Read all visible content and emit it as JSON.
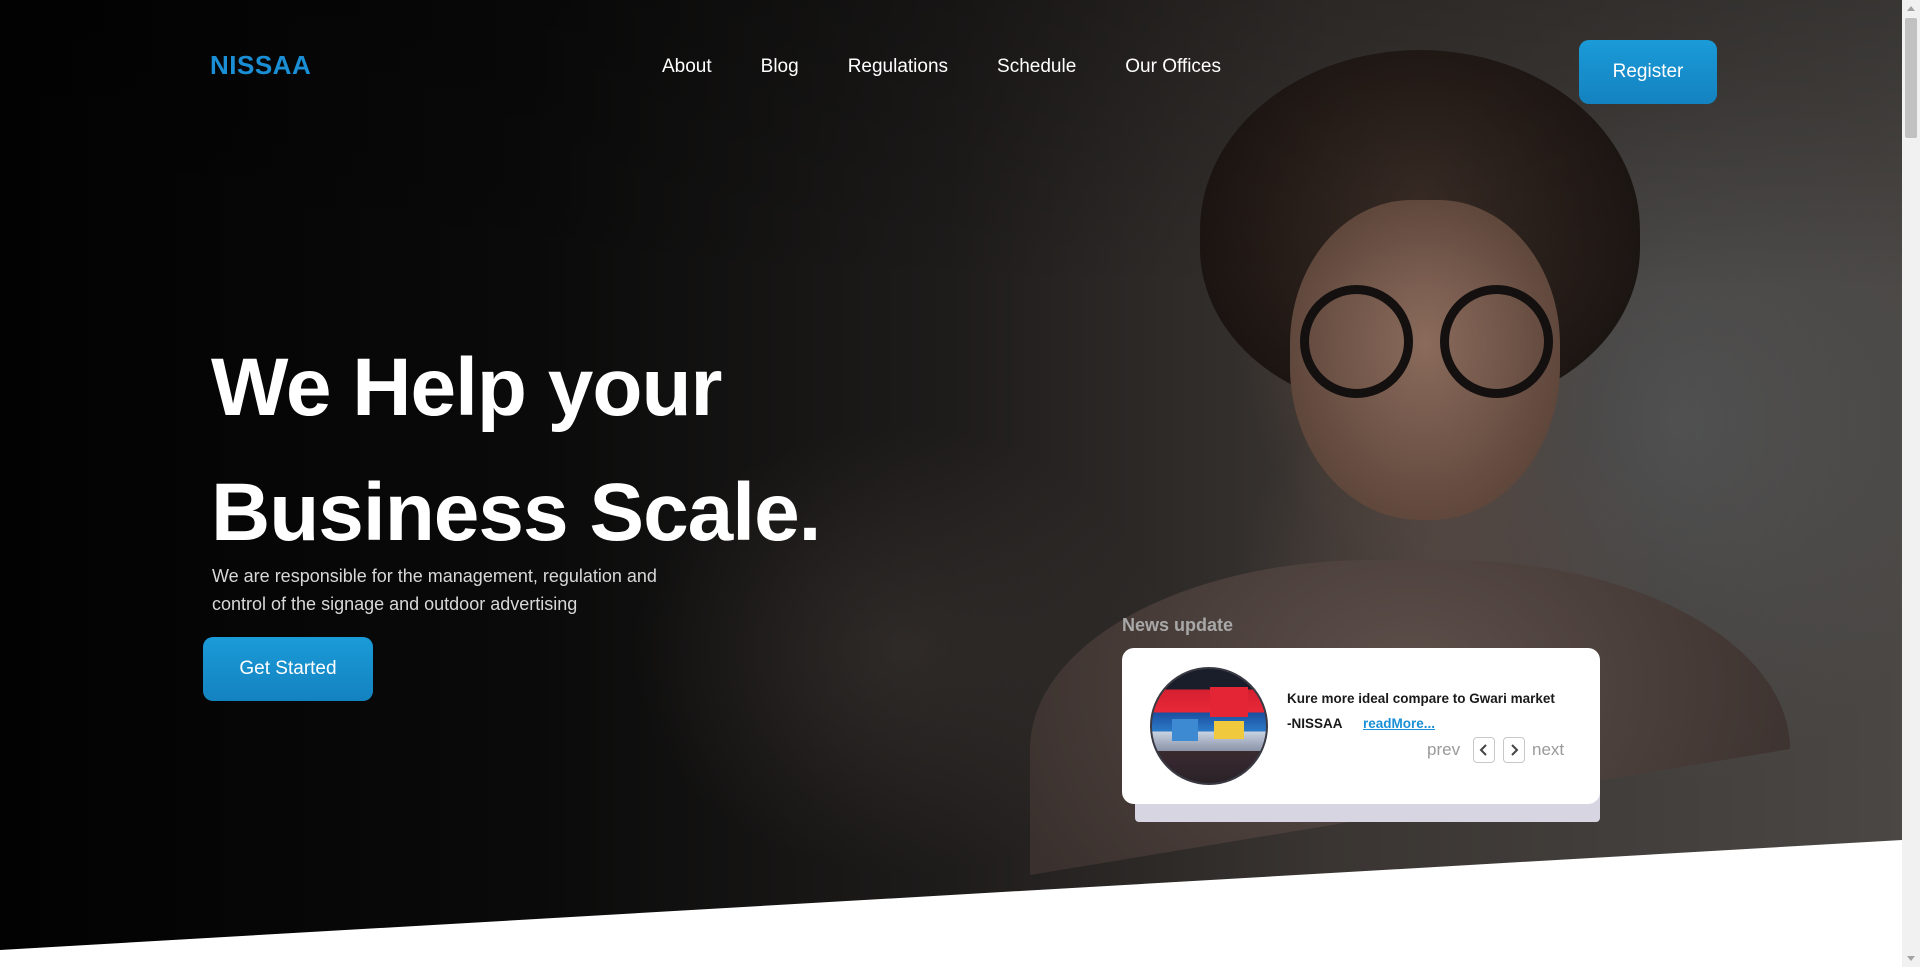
{
  "header": {
    "logo": "NISSAA",
    "nav": [
      "About",
      "Blog",
      "Regulations",
      "Schedule",
      "Our Offices"
    ],
    "register_label": "Register"
  },
  "hero": {
    "headline_line1": "We Help your",
    "headline_line2": "Business Scale.",
    "subtext": "We are responsible for the management, regulation and control of the signage and outdoor advertising",
    "cta_label": "Get Started"
  },
  "news": {
    "section_label": "News update",
    "title": "Kure more ideal compare to Gwari market",
    "author": "-NISSAA",
    "link_label": "readMore...",
    "prev_label": "prev",
    "next_label": "next"
  },
  "colors": {
    "accent": "#1b8fd6",
    "button": "#1a9bd8"
  }
}
